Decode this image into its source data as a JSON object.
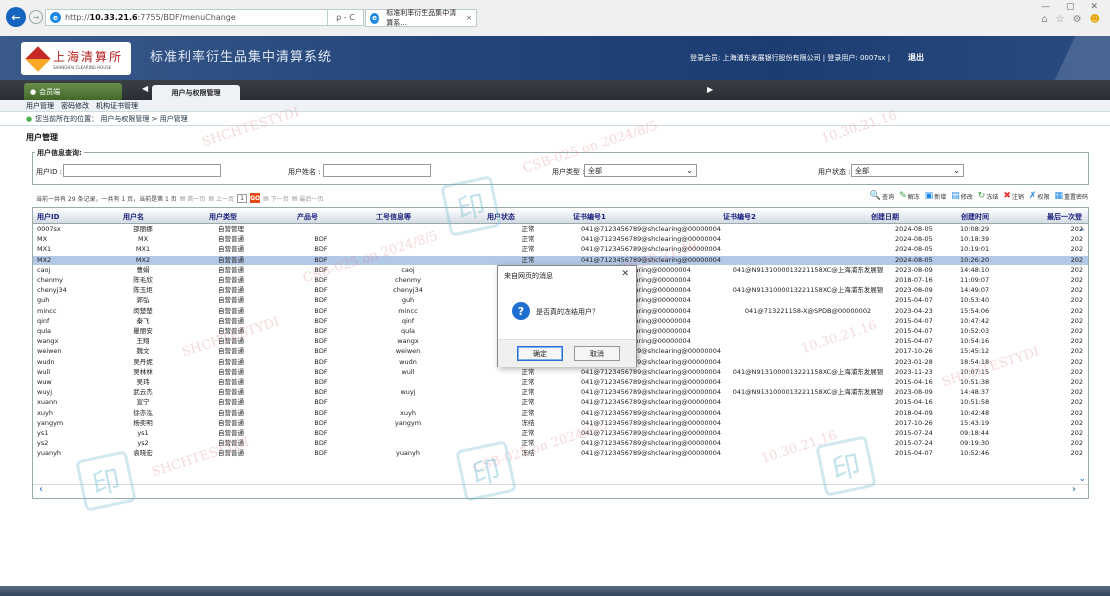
{
  "browser": {
    "url_prefix": "http://",
    "url_host": "10.33.21.6",
    "url_rest": ":7755/BDF/menuChange",
    "search_ctl": "ρ - C",
    "tab_title": "标准利率衍生品集中清算系...",
    "tab_close": "×",
    "back": "←",
    "forward": "→",
    "min": "—",
    "restore": "▢",
    "close": "✕",
    "home_icon": "⌂",
    "star_icon": "☆",
    "gear_icon": "⚙",
    "smile_icon": "☻"
  },
  "header": {
    "logo_cn": "上海清算所",
    "logo_en": "SHANGHAI CLEARING HOUSE",
    "app_title": "标准利率衍生品集中清算系统",
    "user_info": "登录会员: 上海浦东发展银行股份有限公司  |  登录用户: 0007sx  |",
    "logout": "退出"
  },
  "module_bar": {
    "member_tab": "会员端",
    "active_tab": "用户与权限管理",
    "left_arrow": "◀",
    "right_arrow": "▶"
  },
  "sub_menu": [
    "用户管理",
    "密码修改",
    "机构证书管理"
  ],
  "breadcrumb": {
    "icon": "●",
    "text": "您当前所在的位置： 用户与权限管理 > 用户管理"
  },
  "page_title": "用户管理",
  "query": {
    "legend": "用户信息查询:",
    "user_id_label": "用户ID :",
    "user_id_value": "",
    "user_name_label": "用户姓名 :",
    "user_name_value": "",
    "user_type_label": "用户类型 :",
    "user_type_value": "全部",
    "user_status_label": "用户状态 :",
    "user_status_value": "全部"
  },
  "pager": {
    "summary": "当前一共有 29 条记录，一共有 1 页，当前是第 1 页",
    "first": "首一页",
    "prev": "上一页",
    "page_value": "1",
    "go": "GO",
    "next": "下一页",
    "last": "最后一页"
  },
  "toolbar": [
    {
      "icon": "🔍",
      "label": "查询",
      "color": "#1e88e5"
    },
    {
      "icon": "✎",
      "label": "解冻",
      "color": "#43a047"
    },
    {
      "icon": "▣",
      "label": "新增",
      "color": "#1e88e5"
    },
    {
      "icon": "▤",
      "label": "修改",
      "color": "#1e88e5"
    },
    {
      "icon": "↻",
      "label": "冻结",
      "color": "#43a047"
    },
    {
      "icon": "✖",
      "label": "注销",
      "color": "#e53935"
    },
    {
      "icon": "✗",
      "label": "权限",
      "color": "#1e88e5"
    },
    {
      "icon": "▦",
      "label": "重置密码",
      "color": "#1e88e5"
    }
  ],
  "grid": {
    "headers": [
      "用户ID",
      "用户名",
      "用户类型",
      "产品号",
      "工号信息等",
      "用户状态",
      "证书编号1",
      "证书编号2",
      "创建日期",
      "创建时间",
      "最后一次登"
    ],
    "selected_row": 3,
    "rows": [
      [
        "0007sx",
        "邵丽娜",
        "自营管理",
        "",
        "",
        "正常",
        "041@7123456789@shclearing@00000004",
        "",
        "2024-08-05",
        "10:08:29",
        "202"
      ],
      [
        "MX",
        "MX",
        "自营普通",
        "BDF",
        "",
        "正常",
        "041@7123456789@shclearing@00000004",
        "",
        "2024-08-05",
        "10:18:39",
        "202"
      ],
      [
        "MX1",
        "MX1",
        "自营普通",
        "BDF",
        "",
        "正常",
        "041@7123456789@shclearing@00000004",
        "",
        "2024-08-05",
        "10:19:01",
        "202"
      ],
      [
        "MX2",
        "MX2",
        "自营普通",
        "BDF",
        "",
        "正常",
        "041@7123456789@shclearing@00000004",
        "",
        "2024-08-05",
        "10:26:20",
        "202"
      ],
      [
        "caoj",
        "曹娟",
        "自营普通",
        "BDF",
        "caoj",
        "",
        "@shclearing@00000004",
        "041@N9131000013221158XC@上海浦东发展银",
        "2023-08-09",
        "14:48:10",
        "202"
      ],
      [
        "chenmy",
        "陈毛欣",
        "自营普通",
        "BDF",
        "chenmy",
        "",
        "@shclearing@00000004",
        "",
        "2018-07-16",
        "11:09:07",
        "202"
      ],
      [
        "chenyj34",
        "陈玉炬",
        "自营普通",
        "BDF",
        "chenyj34",
        "",
        "@shclearing@00000004",
        "041@N9131000013221158XC@上海浦东发展银",
        "2023-08-09",
        "14:49:07",
        "202"
      ],
      [
        "guh",
        "郭弘",
        "自营普通",
        "BDF",
        "guh",
        "",
        "@shclearing@00000004",
        "",
        "2015-04-07",
        "10:53:40",
        "202"
      ],
      [
        "mincc",
        "闵楚楚",
        "自营普通",
        "BDF",
        "mincc",
        "",
        "@shclearing@00000004",
        "041@713221158-X@SPDB@00000002",
        "2023-04-23",
        "15:54:06",
        "202"
      ],
      [
        "qinf",
        "秦飞",
        "自营普通",
        "BDF",
        "qinf",
        "",
        "@shclearing@00000004",
        "",
        "2015-04-07",
        "10:47:42",
        "202"
      ],
      [
        "qula",
        "瞿丽安",
        "自营普通",
        "BDF",
        "qula",
        "",
        "@shclearing@00000004",
        "",
        "2015-04-07",
        "10:52:03",
        "202"
      ],
      [
        "wangx",
        "王翔",
        "自营普通",
        "BDF",
        "wangx",
        "",
        "@shclearing@00000004",
        "",
        "2015-04-07",
        "10:54:16",
        "202"
      ],
      [
        "weiwen",
        "魏文",
        "自营普通",
        "BDF",
        "weiwen",
        "注销",
        "041@7123456789@shclearing@00000004",
        "",
        "2017-10-26",
        "15:45:12",
        "202"
      ],
      [
        "wudn",
        "吴丹妮",
        "自营普通",
        "BDF",
        "wudn",
        "正常",
        "041@7123456789@shclearing@00000004",
        "",
        "2023-01-28",
        "18:54:18",
        "202"
      ],
      [
        "wull",
        "吴林林",
        "自营普通",
        "BDF",
        "wull",
        "正常",
        "041@7123456789@shclearing@00000004",
        "041@N9131000013221158XC@上海浦东发展银",
        "2023-11-23",
        "10:07:15",
        "202"
      ],
      [
        "wuw",
        "吴玮",
        "自营普通",
        "BDF",
        "",
        "正常",
        "041@7123456789@shclearing@00000004",
        "",
        "2015-04-16",
        "10:51:38",
        "202"
      ],
      [
        "wuyj",
        "武云杰",
        "自营普通",
        "BDF",
        "wuyj",
        "正常",
        "041@7123456789@shclearing@00000004",
        "041@N9131000013221158XC@上海浦东发展银",
        "2023-08-09",
        "14:48:37",
        "202"
      ],
      [
        "xuann",
        "宣宁",
        "自营普通",
        "BDF",
        "",
        "正常",
        "041@7123456789@shclearing@00000004",
        "",
        "2015-04-16",
        "10:51:58",
        "202"
      ],
      [
        "xuyh",
        "徐亦泓",
        "自营普通",
        "BDF",
        "xuyh",
        "正常",
        "041@7123456789@shclearing@00000004",
        "",
        "2018-04-09",
        "10:42:48",
        "202"
      ],
      [
        "yangym",
        "杨奕明",
        "自营普通",
        "BDF",
        "yangym",
        "冻结",
        "041@7123456789@shclearing@00000004",
        "",
        "2017-10-26",
        "15:43:19",
        "202"
      ],
      [
        "ys1",
        "ys1",
        "自营普通",
        "BDF",
        "",
        "正常",
        "041@7123456789@shclearing@00000004",
        "",
        "2015-07-24",
        "09:18:44",
        "202"
      ],
      [
        "ys2",
        "ys2",
        "自营普通",
        "BDF",
        "",
        "正常",
        "041@7123456789@shclearing@00000004",
        "",
        "2015-07-24",
        "09:19:30",
        "202"
      ],
      [
        "yuanyh",
        "袁晓宏",
        "自营普通",
        "BDF",
        "yuanyh",
        "冻结",
        "041@7123456789@shclearing@00000004",
        "",
        "2015-04-07",
        "10:52:46",
        "202"
      ]
    ]
  },
  "watermarks": [
    "SHCHTESTYDI",
    "CSB-025 on 2024/8/5",
    "10.30.21.16",
    "印"
  ],
  "dialog": {
    "title": "来自网页的消息",
    "close": "✕",
    "icon": "?",
    "message": "是否真的冻结用户？",
    "ok": "确定",
    "cancel": "取消"
  }
}
